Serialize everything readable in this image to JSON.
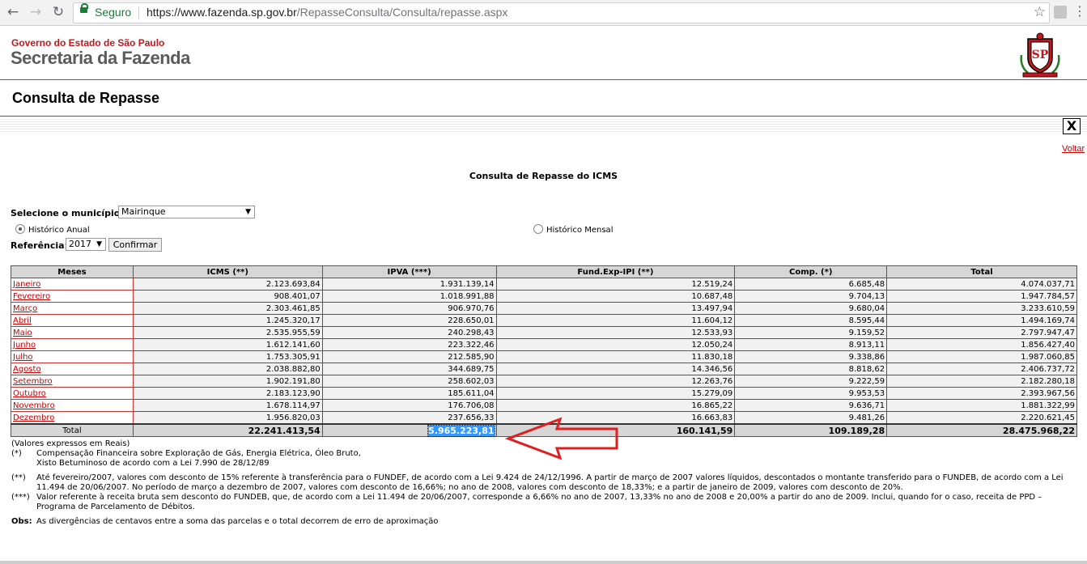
{
  "browser": {
    "secure_label": "Seguro",
    "url_host": "https://www.fazenda.sp.gov.br",
    "url_path": "/RepasseConsulta/Consulta/repasse.aspx"
  },
  "header": {
    "gov_label": "Governo do Estado de São Paulo",
    "secretaria": "Secretaria da Fazenda",
    "seal_text": "SP"
  },
  "page": {
    "title": "Consulta de Repasse",
    "close_label": "X",
    "voltar": "Voltar",
    "subtitle": "Consulta de Repasse do ICMS"
  },
  "form": {
    "municipio_label": "Selecione o município:",
    "municipio_value": "Mairinque",
    "radio_anual": "Histórico Anual",
    "radio_mensal": "Histórico Mensal",
    "referencia_label": "Referência:",
    "referencia_value": "2017",
    "confirmar": "Confirmar"
  },
  "table": {
    "headers": [
      "Meses",
      "ICMS (**)",
      "IPVA (***)",
      "Fund.Exp-IPI (**)",
      "Comp. (*)",
      "Total"
    ],
    "rows": [
      {
        "mes": "Janeiro",
        "icms": "2.123.693,84",
        "ipva": "1.931.139,14",
        "ipi": "12.519,24",
        "comp": "6.685,48",
        "total": "4.074.037,71"
      },
      {
        "mes": "Fevereiro",
        "icms": "908.401,07",
        "ipva": "1.018.991,88",
        "ipi": "10.687,48",
        "comp": "9.704,13",
        "total": "1.947.784,57"
      },
      {
        "mes": "Março",
        "icms": "2.303.461,85",
        "ipva": "906.970,76",
        "ipi": "13.497,94",
        "comp": "9.680,04",
        "total": "3.233.610,59"
      },
      {
        "mes": "Abril",
        "icms": "1.245.320,17",
        "ipva": "228.650,01",
        "ipi": "11.604,12",
        "comp": "8.595,44",
        "total": "1.494.169,74"
      },
      {
        "mes": "Maio",
        "icms": "2.535.955,59",
        "ipva": "240.298,43",
        "ipi": "12.533,93",
        "comp": "9.159,52",
        "total": "2.797.947,47"
      },
      {
        "mes": "Junho",
        "icms": "1.612.141,60",
        "ipva": "223.322,46",
        "ipi": "12.050,24",
        "comp": "8.913,11",
        "total": "1.856.427,40"
      },
      {
        "mes": "Julho",
        "icms": "1.753.305,91",
        "ipva": "212.585,90",
        "ipi": "11.830,18",
        "comp": "9.338,86",
        "total": "1.987.060,85"
      },
      {
        "mes": "Agosto",
        "icms": "2.038.882,80",
        "ipva": "344.689,75",
        "ipi": "14.346,56",
        "comp": "8.818,62",
        "total": "2.406.737,72"
      },
      {
        "mes": "Setembro",
        "icms": "1.902.191,80",
        "ipva": "258.602,03",
        "ipi": "12.263,76",
        "comp": "9.222,59",
        "total": "2.182.280,18"
      },
      {
        "mes": "Outubro",
        "icms": "2.183.123,90",
        "ipva": "185.611,04",
        "ipi": "15.279,09",
        "comp": "9.953,53",
        "total": "2.393.967,56"
      },
      {
        "mes": "Novembro",
        "icms": "1.678.114,97",
        "ipva": "176.706,08",
        "ipi": "16.865,22",
        "comp": "9.636,71",
        "total": "1.881.322,99"
      },
      {
        "mes": "Dezembro",
        "icms": "1.956.820,03",
        "ipva": "237.656,33",
        "ipi": "16.663,83",
        "comp": "9.481,26",
        "total": "2.220.621,45"
      }
    ],
    "total_label": "Total",
    "totals": {
      "icms": "22.241.413,54",
      "ipva": "5.965.223,81",
      "ipi": "160.141,59",
      "comp": "109.189,28",
      "total": "28.475.968,22"
    }
  },
  "notes": {
    "reais": "(Valores expressos em Reais)",
    "n1_key": "(*)",
    "n1_line1": "Compensação Financeira sobre Exploração de Gás, Energia Elétrica, Óleo Bruto,",
    "n1_line2": "Xisto Betuminoso de acordo com a Lei 7.990 de 28/12/89",
    "n2_key": "(**)",
    "n2_line1": "Até fevereiro/2007, valores com desconto de 15% referente à transferência para o FUNDEF, de acordo com a Lei 9.424 de 24/12/1996. A partir de março de 2007 valores líquidos, descontados o montante transferido para o FUNDEB, de acordo com a Lei",
    "n2_line2": "11.494 de 20/06/2007. No período de março a dezembro de 2007, valores com desconto de 16,66%; no ano de 2008, valores com desconto de 18,33%; e a partir de janeiro de 2009, valores com desconto de 20%.",
    "n3_key": "(***)",
    "n3_line1": "Valor referente à receita bruta sem desconto do FUNDEB, que, de acordo com a Lei 11.494 de 20/06/2007, corresponde a 6,66% no ano de 2007, 13,33% no ano de 2008 e 20,00% a partir do ano de 2009. Inclui, quando for o caso, receita de PPD –",
    "n3_line2": "Programa de Parcelamento de Débitos.",
    "obs_key": "Obs:",
    "obs_text": "As divergências de centavos entre a soma das parcelas e o total decorrem de erro de aproximação"
  },
  "colors": {
    "accent_red": "#c4161c",
    "link_red": "#cc0000",
    "annotation_arrow": "#e02020",
    "selection": "#3399ff"
  }
}
